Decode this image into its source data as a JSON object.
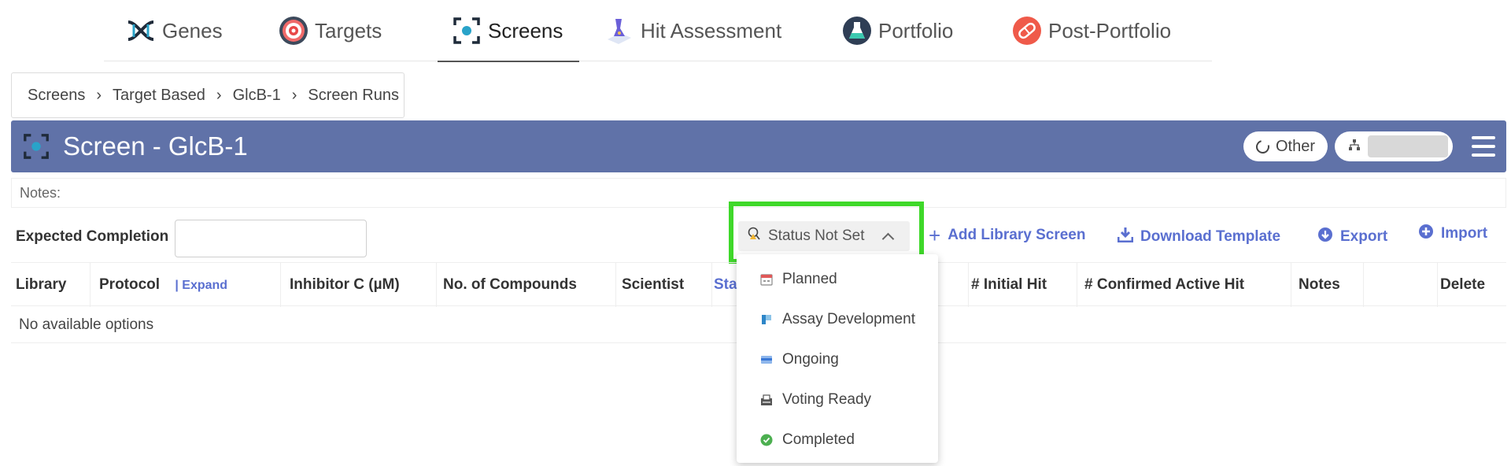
{
  "nav": {
    "tabs": [
      {
        "label": "Genes",
        "icon": "dna-icon"
      },
      {
        "label": "Targets",
        "icon": "target-icon"
      },
      {
        "label": "Screens",
        "icon": "screen-icon",
        "active": true
      },
      {
        "label": "Hit Assessment",
        "icon": "flask-icon"
      },
      {
        "label": "Portfolio",
        "icon": "portfolio-flask-icon"
      },
      {
        "label": "Post-Portfolio",
        "icon": "pill-icon"
      }
    ]
  },
  "breadcrumb": [
    "Screens",
    "Target Based",
    "GlcB-1",
    "Screen Runs"
  ],
  "header": {
    "title": "Screen - GlcB-1",
    "org_label": "Other",
    "color": "#6072a8"
  },
  "notes_label": "Notes:",
  "toolbar": {
    "expected_completion_label": "Expected Completion",
    "expected_completion_value": "",
    "status_label": "Status Not Set",
    "add_library_label": "Add Library Screen",
    "download_template_label": "Download Template",
    "export_label": "Export",
    "import_label": "Import",
    "accent": "#5a6fd0",
    "highlight_color": "#3fd82a"
  },
  "table": {
    "columns": {
      "library": "Library",
      "protocol": "Protocol",
      "expand": "| Expand",
      "inhibitor": "Inhibitor C (µM)",
      "compounds": "No. of Compounds",
      "scientist": "Scientist",
      "status": "Sta",
      "initial_hit": "# Initial Hit",
      "confirmed_hit": "# Confirmed Active Hit",
      "notes": "Notes",
      "delete": "Delete"
    },
    "empty_text": "No available options"
  },
  "status_menu": {
    "options": [
      {
        "label": "Planned",
        "icon": "calendar-icon"
      },
      {
        "label": "Assay Development",
        "icon": "assay-icon"
      },
      {
        "label": "Ongoing",
        "icon": "ongoing-icon"
      },
      {
        "label": "Voting Ready",
        "icon": "voting-icon"
      },
      {
        "label": "Completed",
        "icon": "check-circle-icon",
        "color": "#4caf50"
      }
    ]
  }
}
